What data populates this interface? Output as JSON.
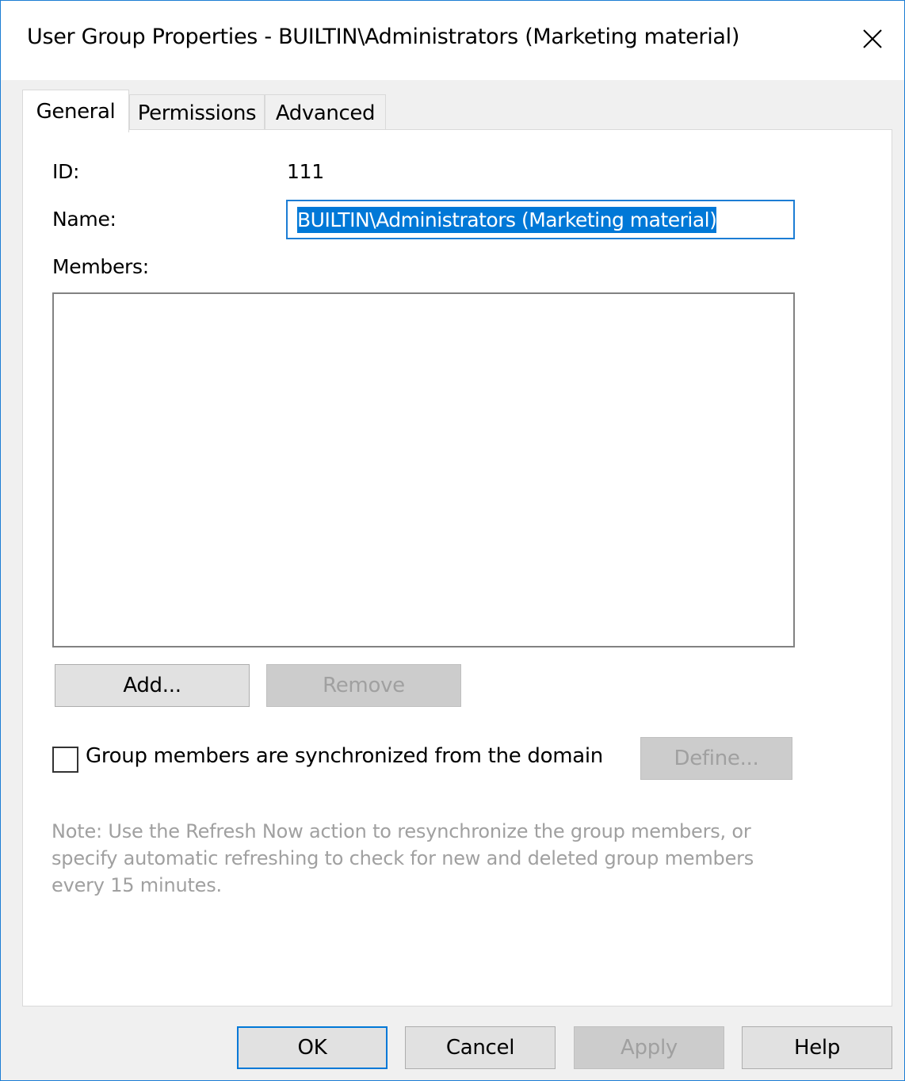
{
  "window": {
    "title": "User Group Properties - BUILTIN\\Administrators (Marketing material)",
    "close_icon": "close-icon"
  },
  "tabs": [
    {
      "label": "General",
      "active": true
    },
    {
      "label": "Permissions",
      "active": false
    },
    {
      "label": "Advanced",
      "active": false
    }
  ],
  "general": {
    "id_label": "ID:",
    "id_value": "111",
    "name_label": "Name:",
    "name_value": "BUILTIN\\Administrators (Marketing material)",
    "members_label": "Members:",
    "members": [],
    "add_button": "Add...",
    "remove_button": "Remove",
    "sync_checkbox_label": "Group members are synchronized from the domain",
    "sync_checked": false,
    "define_button": "Define...",
    "note": "Note: Use the Refresh Now action to resynchronize the group members, or specify automatic refreshing to check for new and deleted group members every 15 minutes."
  },
  "footer": {
    "ok": "OK",
    "cancel": "Cancel",
    "apply": "Apply",
    "help": "Help"
  },
  "colors": {
    "accent": "#0078d7",
    "window_border": "#1c7dd4",
    "disabled_text": "#a0a0a0"
  }
}
